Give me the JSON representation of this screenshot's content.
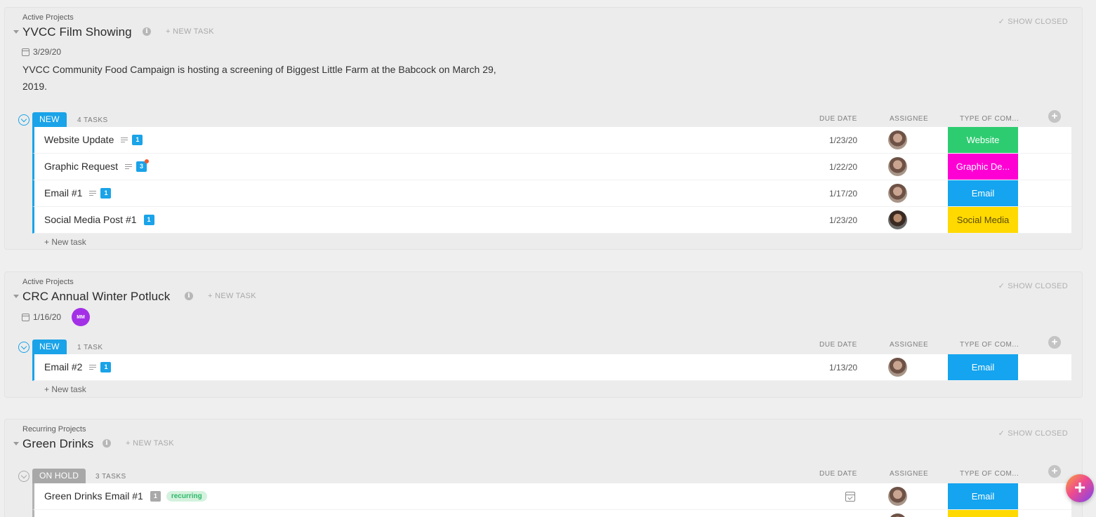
{
  "projects": [
    {
      "crumb": "Active Projects",
      "title": "YVCC Film Showing",
      "new_task": "+ NEW TASK",
      "show_closed": "SHOW CLOSED",
      "date": "3/29/20",
      "description": "YVCC Community Food Campaign is hosting a screening of Biggest Little Farm at the Babcock on March 29, 2019.",
      "group": {
        "status": "NEW",
        "status_color": "#1aa3e8",
        "count": "4 TASKS",
        "headers": {
          "due": "DUE DATE",
          "assignee": "ASSIGNEE",
          "type": "TYPE OF COM..."
        },
        "tasks": [
          {
            "name": "Website Update",
            "count": "1",
            "due": "1/23/20",
            "type": "Website",
            "type_color": "#2ecc71"
          },
          {
            "name": "Graphic Request",
            "count": "3",
            "due": "1/22/20",
            "type": "Graphic De...",
            "type_color": "#ff00d4"
          },
          {
            "name": "Email #1",
            "count": "1",
            "due": "1/17/20",
            "type": "Email",
            "type_color": "#15a4ef"
          },
          {
            "name": "Social Media Post #1",
            "count": "1",
            "due": "1/23/20",
            "type": "Social Media",
            "type_color": "#ffd900"
          }
        ]
      },
      "new_task_bottom": "+ New task"
    },
    {
      "crumb": "Active Projects",
      "title": "CRC Annual Winter Potluck",
      "new_task": "+ NEW TASK",
      "show_closed": "SHOW CLOSED",
      "date": "1/16/20",
      "owner_initials": "MM",
      "group": {
        "status": "NEW",
        "status_color": "#1aa3e8",
        "count": "1 TASK",
        "headers": {
          "due": "DUE DATE",
          "assignee": "ASSIGNEE",
          "type": "TYPE OF COM..."
        },
        "tasks": [
          {
            "name": "Email #2",
            "count": "1",
            "due": "1/13/20",
            "type": "Email",
            "type_color": "#15a4ef"
          }
        ]
      },
      "new_task_bottom": "+ New task"
    },
    {
      "crumb": "Recurring Projects",
      "title": "Green Drinks",
      "new_task": "+ NEW TASK",
      "show_closed": "SHOW CLOSED",
      "group": {
        "status": "ON HOLD",
        "status_color": "#a8a8a8",
        "count": "3 TASKS",
        "headers": {
          "due": "DUE DATE",
          "assignee": "ASSIGNEE",
          "type": "TYPE OF COM..."
        },
        "tasks": [
          {
            "name": "Green Drinks Email #1",
            "count": "1",
            "tag": "recurring",
            "type": "Email",
            "type_color": "#15a4ef"
          }
        ]
      }
    }
  ],
  "fab_label": "+"
}
